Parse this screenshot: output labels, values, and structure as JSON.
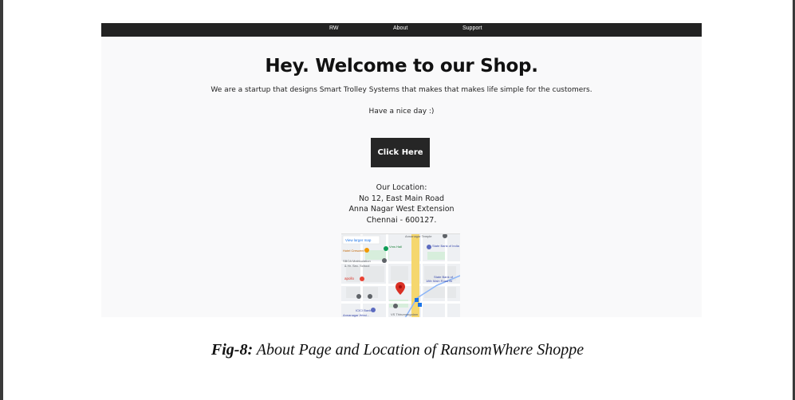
{
  "navbar": {
    "brand": "RW",
    "about": "About",
    "support": "Support"
  },
  "hero": {
    "title": "Hey. Welcome to our Shop.",
    "tagline": "We are a startup that designs Smart Trolley Systems that makes that makes life simple for the customers.",
    "greeting": "Have a nice day :)",
    "button_label": "Click Here"
  },
  "location": {
    "heading": "Our Location:",
    "line1": "No 12, East Main Road",
    "line2": "Anna Nagar West Extension",
    "line3": "Chennai - 600127."
  },
  "map": {
    "view_larger": "View larger map",
    "place_hotel": "Hotel Crescent",
    "place_vms": "Vms Hall",
    "place_sbi": "State Bank of India",
    "place_sboa": "SBOA Matriculation",
    "place_sboa2": "& Hr. Sec. School",
    "place_apollo": "apollo",
    "place_sbi2": "State Bank of",
    "place_sbi2b": "18th Main Road Br",
    "place_icici": "ICICI Bank",
    "place_icici2": "Annanagar West...",
    "place_vs": "VS Thirumangalam",
    "place_top": "Annanagar Temple",
    "marker_color": "#d93025",
    "road_color": "#f5d76e"
  },
  "caption": {
    "fig_label": "Fig-8:",
    "text": " About Page and Location of RansomWhere Shoppe"
  }
}
